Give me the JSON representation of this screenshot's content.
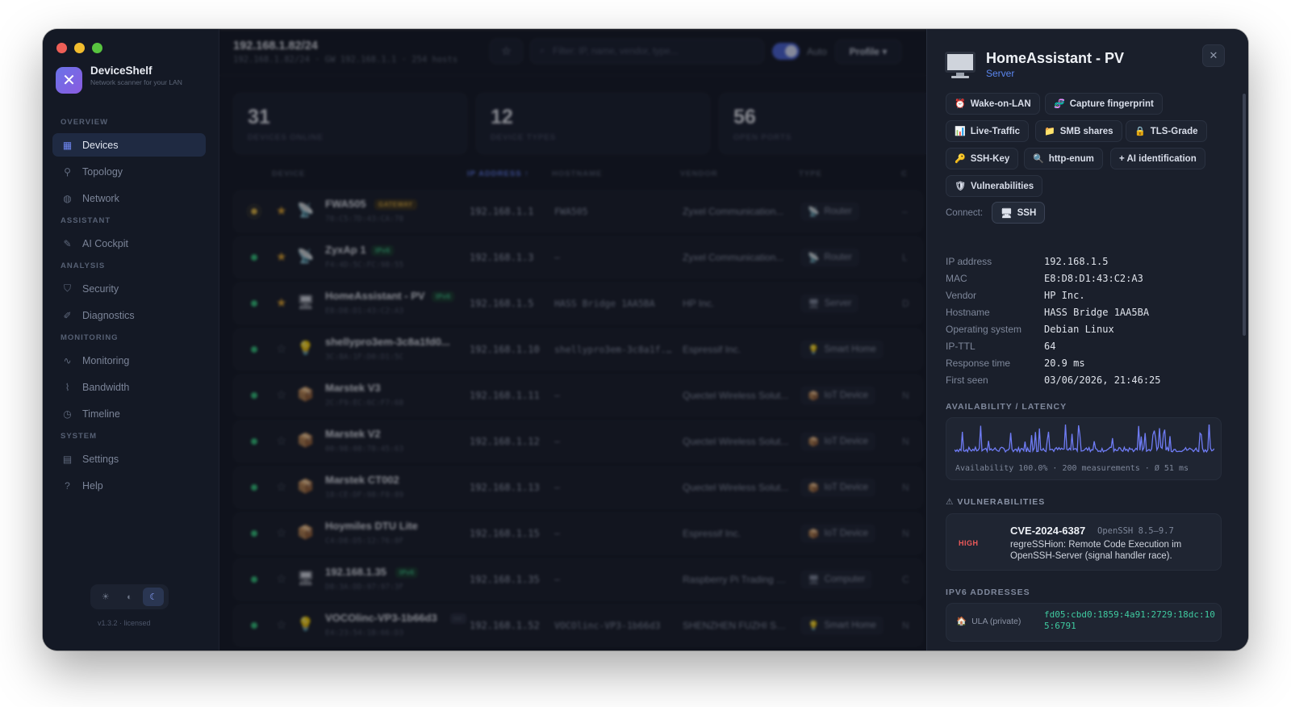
{
  "app": {
    "name": "DeviceShelf",
    "subtitle": "Network scanner for your LAN",
    "version": "v1.3.2 · licensed"
  },
  "sidebar": {
    "sections": [
      {
        "title": "OVERVIEW",
        "items": [
          {
            "label": "Devices",
            "icon": "devices-grid-icon",
            "active": true
          },
          {
            "label": "Topology",
            "icon": "topology-icon"
          },
          {
            "label": "Network",
            "icon": "globe-icon"
          }
        ]
      },
      {
        "title": "ASSISTANT",
        "items": [
          {
            "label": "AI Cockpit",
            "icon": "sparkle-icon"
          }
        ]
      },
      {
        "title": "ANALYSIS",
        "items": [
          {
            "label": "Security",
            "icon": "shield-icon"
          },
          {
            "label": "Diagnostics",
            "icon": "wrench-icon"
          }
        ]
      },
      {
        "title": "MONITORING",
        "items": [
          {
            "label": "Monitoring",
            "icon": "pulse-icon"
          },
          {
            "label": "Bandwidth",
            "icon": "activity-icon"
          },
          {
            "label": "Timeline",
            "icon": "clock-icon"
          }
        ]
      },
      {
        "title": "SYSTEM",
        "items": [
          {
            "label": "Settings",
            "icon": "document-icon"
          },
          {
            "label": "Help",
            "icon": "question-icon"
          }
        ]
      }
    ],
    "theme_options": [
      "☀",
      "◐",
      "☾"
    ]
  },
  "topbar": {
    "network": "192.168.1.82/24",
    "network_meta": "192.168.1.82/24 · GW 192.168.1.1 · 254 hosts",
    "filter_placeholder": "Filter: IP, name, vendor, type...",
    "auto_label": "Auto",
    "auto_enabled": true,
    "profile_label": "Profile ▾"
  },
  "stats": [
    {
      "value": "31",
      "label": "DEVICES ONLINE"
    },
    {
      "value": "12",
      "label": "DEVICE TYPES"
    },
    {
      "value": "56",
      "label": "OPEN PORTS"
    }
  ],
  "table": {
    "columns": {
      "device": "DEVICE",
      "ip": "IP ADDRESS ↑",
      "hostname": "HOSTNAME",
      "vendor": "VENDOR",
      "type": "TYPE",
      "last": "C"
    },
    "rows": [
      {
        "name": "FWA505",
        "badge": "GATEWAY",
        "badge_kind": "gw",
        "mac": "78:C5:7D:43:CA:78",
        "ip": "192.168.1.1",
        "hostname": "FWA505",
        "vendor": "Zyxel Communication...",
        "type": "Router",
        "type_icon": "📡",
        "icon": "📡",
        "fav": true,
        "status": "gateway",
        "last": "–"
      },
      {
        "name": "ZyxAp 1",
        "badge": "IPv6",
        "badge_kind": "v6",
        "mac": "F4:4D:5C:FC:98:55",
        "ip": "192.168.1.3",
        "hostname": "–",
        "vendor": "Zyxel Communication...",
        "type": "Router",
        "type_icon": "📡",
        "icon": "📡",
        "fav": true,
        "status": "online",
        "last": "L"
      },
      {
        "name": "HomeAssistant - PV",
        "badge": "IPv6",
        "badge_kind": "v6",
        "mac": "E8:D8:D1:43:C2:A3",
        "ip": "192.168.1.5",
        "hostname": "HASS Bridge 1AA5BA",
        "vendor": "HP Inc.",
        "type": "Server",
        "type_icon": "🖥",
        "icon": "🖥",
        "fav": true,
        "status": "online",
        "last": "D"
      },
      {
        "name": "shellypro3em-3c8a1fd0...",
        "badge": "",
        "badge_kind": "",
        "mac": "3C:8A:1F:D0:D1:5C",
        "ip": "192.168.1.10",
        "hostname": "shellypro3em-3c8a1f...",
        "vendor": "Espressif Inc.",
        "type": "Smart Home",
        "type_icon": "💡",
        "icon": "💡",
        "fav": false,
        "status": "online",
        "last": ""
      },
      {
        "name": "Marstek V3",
        "badge": "",
        "badge_kind": "",
        "mac": "2C:F9:EC:6C:F7:68",
        "ip": "192.168.1.11",
        "hostname": "–",
        "vendor": "Quectel Wireless Solut...",
        "type": "IoT Device",
        "type_icon": "📦",
        "icon": "📦",
        "fav": false,
        "status": "online",
        "last": "N"
      },
      {
        "name": "Marstek V2",
        "badge": "",
        "badge_kind": "",
        "mac": "00:98:08:78:45:63",
        "ip": "192.168.1.12",
        "hostname": "–",
        "vendor": "Quectel Wireless Solut...",
        "type": "IoT Device",
        "type_icon": "📦",
        "icon": "📦",
        "fav": false,
        "status": "online",
        "last": "N"
      },
      {
        "name": "Marstek CT002",
        "badge": "",
        "badge_kind": "",
        "mac": "18:CE:DF:98:F8:89",
        "ip": "192.168.1.13",
        "hostname": "–",
        "vendor": "Quectel Wireless Solut...",
        "type": "IoT Device",
        "type_icon": "📦",
        "icon": "📦",
        "fav": false,
        "status": "online",
        "last": "N"
      },
      {
        "name": "Hoymiles DTU Lite",
        "badge": "",
        "badge_kind": "",
        "mac": "C4:D8:D5:12:76:8F",
        "ip": "192.168.1.15",
        "hostname": "–",
        "vendor": "Espressif Inc.",
        "type": "IoT Device",
        "type_icon": "📦",
        "icon": "📦",
        "fav": false,
        "status": "online",
        "last": "N"
      },
      {
        "name": "192.168.1.35",
        "badge": "IPv6",
        "badge_kind": "v6",
        "mac": "D8:3A:DD:97:97:3F",
        "ip": "192.168.1.35",
        "hostname": "–",
        "vendor": "Raspberry Pi Trading L...",
        "type": "Computer",
        "type_icon": "🖥",
        "icon": "🖥",
        "fav": false,
        "status": "online",
        "last": "C"
      },
      {
        "name": "VOCOlinc-VP3-1b66d3",
        "badge": "···",
        "badge_kind": "more",
        "mac": "E4:23:54:1B:66:D3",
        "ip": "192.168.1.52",
        "hostname": "VOCOlinc-VP3-1b66d3",
        "vendor": "SHENZHEN FUZHI SO...",
        "type": "Smart Home",
        "type_icon": "💡",
        "icon": "💡",
        "fav": false,
        "status": "online",
        "last": "N"
      }
    ]
  },
  "detail": {
    "title": "HomeAssistant - PV",
    "type": "Server",
    "actions": [
      {
        "label": "Wake-on-LAN",
        "icon": "⏰"
      },
      {
        "label": "Capture fingerprint",
        "icon": "🧬"
      },
      {
        "label": "Live-Traffic",
        "icon": "📊"
      },
      {
        "label": "SMB shares",
        "icon": "📁"
      },
      {
        "label": "TLS-Grade",
        "icon": "🔒"
      },
      {
        "label": "SSH-Key",
        "icon": "🔑"
      },
      {
        "label": "http-enum",
        "icon": "🔍"
      },
      {
        "label": "+ AI identification",
        "icon": ""
      },
      {
        "label": "Vulnerabilities",
        "icon": "🛡"
      }
    ],
    "connect_label": "Connect:",
    "connect_ssh": "SSH",
    "info": [
      {
        "k": "IP address",
        "v": "192.168.1.5"
      },
      {
        "k": "MAC",
        "v": "E8:D8:D1:43:C2:A3"
      },
      {
        "k": "Vendor",
        "v": "HP Inc."
      },
      {
        "k": "Hostname",
        "v": "HASS Bridge 1AA5BA"
      },
      {
        "k": "Operating system",
        "v": "Debian Linux"
      },
      {
        "k": "IP-TTL",
        "v": "64"
      },
      {
        "k": "Response time",
        "v": "20.9 ms"
      },
      {
        "k": "First seen",
        "v": "03/06/2026, 21:46:25"
      }
    ],
    "availability_title": "AVAILABILITY / LATENCY",
    "availability_caption": "Availability 100.0% · 200 measurements · Ø 51 ms",
    "latency_color": "#6f7cf5",
    "vuln_title": "⚠ VULNERABILITIES",
    "vuln": {
      "severity": "HIGH",
      "id": "CVE-2024-6387",
      "product": "OpenSSH 8.5–9.7",
      "description": "regreSSHion: Remote Code Execution im OpenSSH-Server (signal handler race)."
    },
    "ipv6_title": "IPV6 ADDRESSES",
    "ipv6": {
      "scope": "ULA (private)",
      "address": "fd05:cbd0:1859:4a91:2729:18dc:105:6791"
    }
  },
  "colors": {
    "accent": "#5b7cf0",
    "online": "#35c47d",
    "gateway": "#e1b844",
    "favorite": "#e3a832",
    "high": "#ef5a5a",
    "ipv6": "#3fcaa0"
  }
}
